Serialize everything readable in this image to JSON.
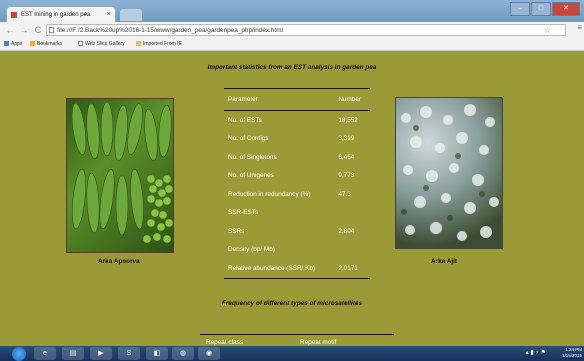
{
  "browser": {
    "tab_title": "EST mining in garden pea",
    "tab_close": "×",
    "url": "file:///F:/2.Back%20up%2016-1-15/www/garden_pea/gardenpea_php/index.html",
    "bookmarks": [
      "Apps",
      "Bookmarks",
      "Web Slice Gallery",
      "Imported From IE"
    ]
  },
  "page": {
    "heading": "Important statistics from an EST analysis in garden pea",
    "stats_table": {
      "headers": [
        "Parameter",
        "Number"
      ],
      "rows": [
        [
          "No. of ESTs",
          "18,552"
        ],
        [
          "No. of Contigs",
          "3,319"
        ],
        [
          "No. of Singletons",
          "6,454"
        ],
        [
          "No. of Unigenes",
          "9,773"
        ],
        [
          "Reduction in redundancy (%)",
          "47.3"
        ],
        [
          "SSR-ESTs",
          ""
        ],
        [
          "SSRs",
          "2,804"
        ],
        [
          "Density (bp/ Mb)",
          ""
        ],
        [
          "Relative abundance (SSR/ Kb)",
          "2.0171"
        ]
      ]
    },
    "left_caption": "Arka Apoorva",
    "right_caption": "Arka Ajit",
    "heading2": "Frequency of different types of microsatellites",
    "ms_headers": [
      "Repeat class",
      "Repeat motif"
    ]
  },
  "taskbar": {
    "time": "1:24 PM",
    "date": "1/15/2015"
  },
  "colors": {
    "page_bg": "#9a9a37",
    "table_text": "#ffffff",
    "taskbar": "#1f3d69"
  }
}
